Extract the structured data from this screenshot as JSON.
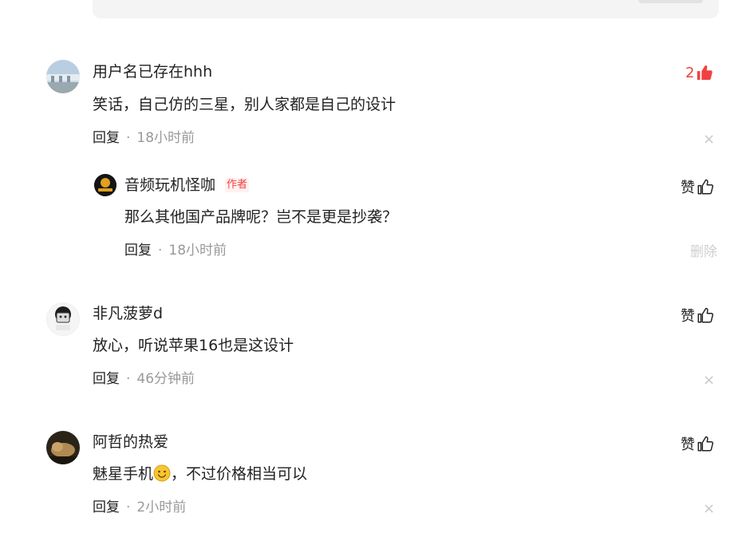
{
  "comments": [
    {
      "username": "用户名已存在hhh",
      "text": "笑话，自己仿的三星，别人家都是自己的设计",
      "reply_label": "回复",
      "separator": "·",
      "time": "18小时前",
      "like_count": "2",
      "like_active": true,
      "close_glyph": "×",
      "reply": {
        "username": "音频玩机怪咖",
        "author_badge": "作者",
        "text": "那么其他国产品牌呢？岂不是更是抄袭？",
        "reply_label": "回复",
        "separator": "·",
        "time": "18小时前",
        "like_label": "赞",
        "delete_label": "删除"
      }
    },
    {
      "username": "非凡菠萝d",
      "text": "放心，听说苹果16也是这设计",
      "reply_label": "回复",
      "separator": "·",
      "time": "46分钟前",
      "like_label": "赞",
      "close_glyph": "×"
    },
    {
      "username": "阿哲的热爱",
      "text_before_emoji": "魅星手机",
      "emoji": "smile-emoji",
      "text_after_emoji": "，不过价格相当可以",
      "reply_label": "回复",
      "separator": "·",
      "time": "2小时前",
      "like_label": "赞",
      "close_glyph": "×"
    }
  ],
  "colors": {
    "accent_red": "#f04142",
    "muted_text": "#999999",
    "main_text": "#222222"
  }
}
